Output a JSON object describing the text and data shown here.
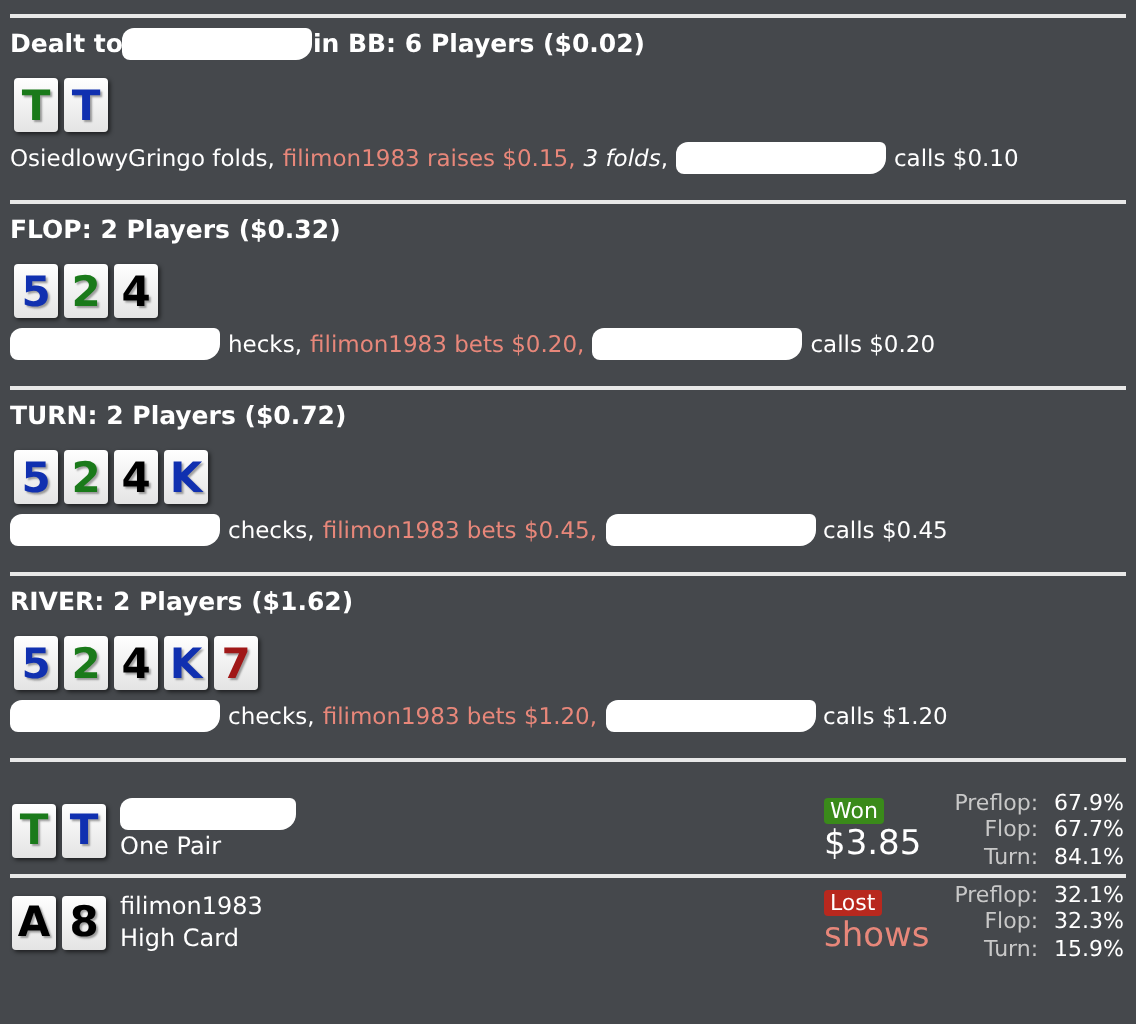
{
  "streets": [
    {
      "title_parts": [
        {
          "kind": "plain",
          "text": "Dealt to "
        },
        {
          "kind": "redacted"
        },
        {
          "kind": "plain",
          "text": "in BB: 6 Players ($0.02)"
        }
      ],
      "cards": [
        {
          "rank": "T",
          "color": "#1a7a1a"
        },
        {
          "rank": "T",
          "color": "#1030b0"
        }
      ],
      "actions": [
        {
          "kind": "plain",
          "text": "OsiedlowyGringo folds,"
        },
        {
          "kind": "hero",
          "text": "filimon1983 raises $0.15,"
        },
        {
          "kind": "italic",
          "text": "3 folds"
        },
        {
          "kind": "plain",
          "text": ","
        },
        {
          "kind": "redacted"
        },
        {
          "kind": "plain",
          "text": "calls $0.10"
        }
      ]
    },
    {
      "title_parts": [
        {
          "kind": "plain",
          "text": "FLOP: 2 Players ($0.32)"
        }
      ],
      "cards": [
        {
          "rank": "5",
          "color": "#1030b0"
        },
        {
          "rank": "2",
          "color": "#1a7a1a"
        },
        {
          "rank": "4",
          "color": "#000000"
        }
      ],
      "actions": [
        {
          "kind": "redacted"
        },
        {
          "kind": "plain",
          "text": "hecks,"
        },
        {
          "kind": "hero",
          "text": "filimon1983 bets $0.20,"
        },
        {
          "kind": "redacted"
        },
        {
          "kind": "plain",
          "text": "calls $0.20"
        }
      ]
    },
    {
      "title_parts": [
        {
          "kind": "plain",
          "text": "TURN: 2 Players ($0.72)"
        }
      ],
      "cards": [
        {
          "rank": "5",
          "color": "#1030b0"
        },
        {
          "rank": "2",
          "color": "#1a7a1a"
        },
        {
          "rank": "4",
          "color": "#000000"
        },
        {
          "rank": "K",
          "color": "#1030b0"
        }
      ],
      "actions": [
        {
          "kind": "redacted"
        },
        {
          "kind": "plain",
          "text": "checks,"
        },
        {
          "kind": "hero",
          "text": "filimon1983 bets $0.45,"
        },
        {
          "kind": "redacted"
        },
        {
          "kind": "plain",
          "text": "calls $0.45"
        }
      ]
    },
    {
      "title_parts": [
        {
          "kind": "plain",
          "text": "RIVER: 2 Players ($1.62)"
        }
      ],
      "cards": [
        {
          "rank": "5",
          "color": "#1030b0"
        },
        {
          "rank": "2",
          "color": "#1a7a1a"
        },
        {
          "rank": "4",
          "color": "#000000"
        },
        {
          "rank": "K",
          "color": "#1030b0"
        },
        {
          "rank": "7",
          "color": "#a01818"
        }
      ],
      "actions": [
        {
          "kind": "redacted"
        },
        {
          "kind": "plain",
          "text": "checks,"
        },
        {
          "kind": "hero",
          "text": "filimon1983 bets $1.20,"
        },
        {
          "kind": "redacted"
        },
        {
          "kind": "plain",
          "text": "calls $1.20"
        }
      ]
    }
  ],
  "results": [
    {
      "cards": [
        {
          "rank": "T",
          "color": "#1a7a1a"
        },
        {
          "rank": "T",
          "color": "#1030b0"
        }
      ],
      "name_redacted": true,
      "hand": "One Pair",
      "won": true,
      "badge": "Won",
      "amount": "$3.85",
      "equity": [
        {
          "label": "Preflop:",
          "value": "67.9%"
        },
        {
          "label": "Flop:",
          "value": "67.7%"
        },
        {
          "label": "Turn:",
          "value": "84.1%"
        }
      ]
    },
    {
      "cards": [
        {
          "rank": "A",
          "color": "#000000"
        },
        {
          "rank": "8",
          "color": "#000000"
        }
      ],
      "name": "filimon1983",
      "name_redacted": false,
      "hand": "High Card",
      "won": false,
      "badge": "Lost",
      "amount": "shows",
      "equity": [
        {
          "label": "Preflop:",
          "value": "32.1%"
        },
        {
          "label": "Flop:",
          "value": "32.3%"
        },
        {
          "label": "Turn:",
          "value": "15.9%"
        }
      ]
    }
  ]
}
